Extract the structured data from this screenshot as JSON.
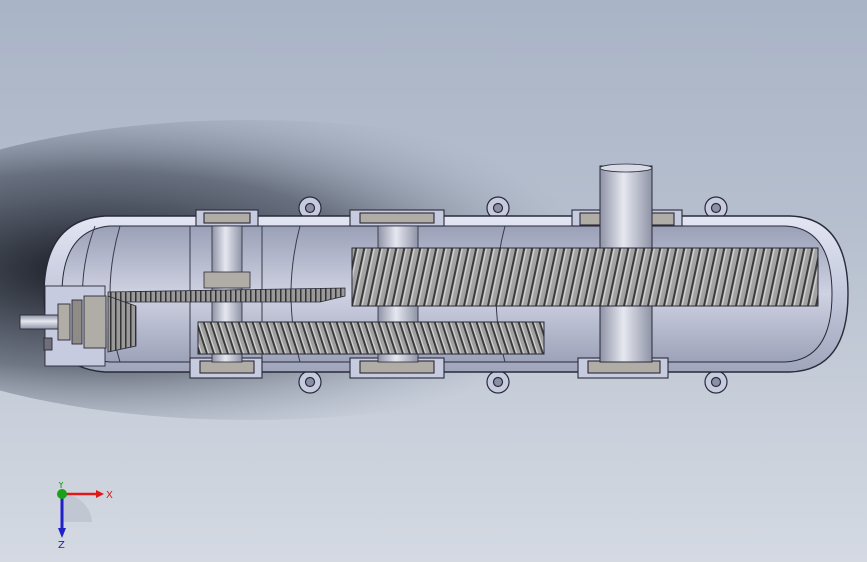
{
  "viewport": {
    "background_top": "#a9b4c6",
    "background_bottom": "#d4d9e2",
    "model": {
      "housing_color": "#c7cbe0",
      "housing_edge_color": "#2a2a38",
      "gear_color": "#9b9b9b",
      "bearing_color": "#b0aca6",
      "shaft_color": "#b8bccb"
    }
  },
  "triad": {
    "x_label": "X",
    "y_label": "Y",
    "z_label": "Z",
    "x_color": "#e01818",
    "y_color": "#1aa01a",
    "z_color": "#2020c8"
  }
}
